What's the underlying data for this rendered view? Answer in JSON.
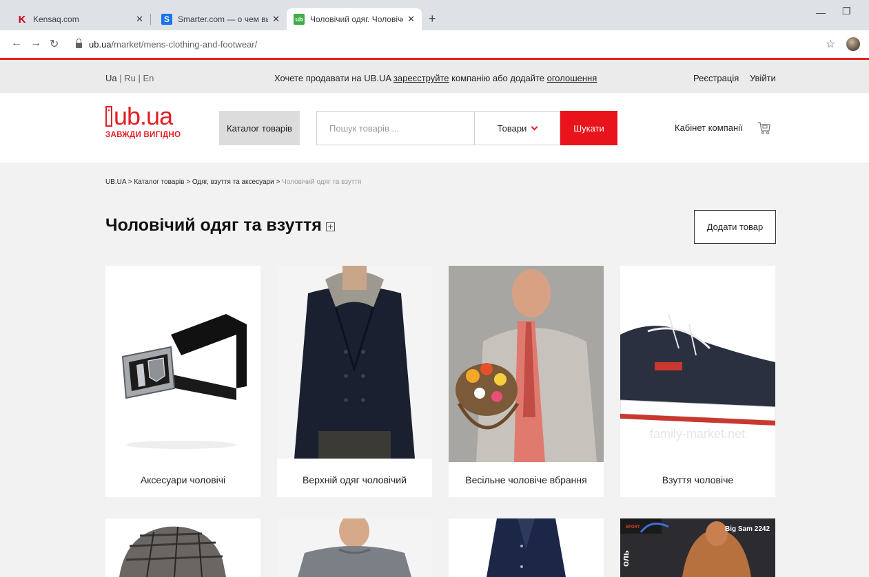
{
  "browser": {
    "tabs": [
      {
        "title": "Kensaq.com",
        "icon": "K"
      },
      {
        "title": "Smarter.com — о чем вы хотите",
        "icon": "S"
      },
      {
        "title": "Чоловічий одяг. Чоловіче взут",
        "icon": "ub"
      }
    ],
    "url_host": "ub.ua",
    "url_path": "/market/mens-clothing-and-footwear/"
  },
  "topbar": {
    "lang_ua": "Ua",
    "lang_ru": "Ru",
    "lang_en": "En",
    "promo_prefix": "Хочете продавати на UB.UA ",
    "promo_link1": "зареєструйте",
    "promo_mid": " компанію або додайте ",
    "promo_link2": "оголошення",
    "register": "Реєстрація",
    "login": "Увійти"
  },
  "header": {
    "logo_text": "ub.ua",
    "logo_tagline": "ЗАВЖДИ ВИГІДНО",
    "catalog_button": "Каталог товарів",
    "search_placeholder": "Пошук товарів ...",
    "search_scope": "Товари",
    "search_button": "Шукати",
    "cabinet": "Кабінет компанії"
  },
  "breadcrumbs": {
    "items": [
      "UB.UA",
      "Каталог товарів",
      "Одяг, взуття та аксесуари"
    ],
    "separator": " > ",
    "current": "Чоловічий одяг та взуття"
  },
  "page": {
    "title": "Чоловічий одяг та взуття",
    "add_button": "Додати товар"
  },
  "categories": [
    {
      "label": "Аксесуари чоловічі",
      "icon": "belt-image"
    },
    {
      "label": "Верхній одяг чоловічий",
      "icon": "coat-image"
    },
    {
      "label": "Весільне чоловіче вбрання",
      "icon": "wedding-suit-image"
    },
    {
      "label": "Взуття чоловіче",
      "icon": "shoe-image",
      "watermark": "family-market.net"
    },
    {
      "label": "",
      "icon": "cap-image"
    },
    {
      "label": "",
      "icon": "sweater-image"
    },
    {
      "label": "",
      "icon": "jacket-image"
    },
    {
      "label": "",
      "icon": "sport-image",
      "badge": "Big Sam 2242",
      "side_text": "оль",
      "brand_text": "SPORT"
    }
  ],
  "colors": {
    "accent": "#e31e24",
    "search_button": "#e8131b"
  }
}
